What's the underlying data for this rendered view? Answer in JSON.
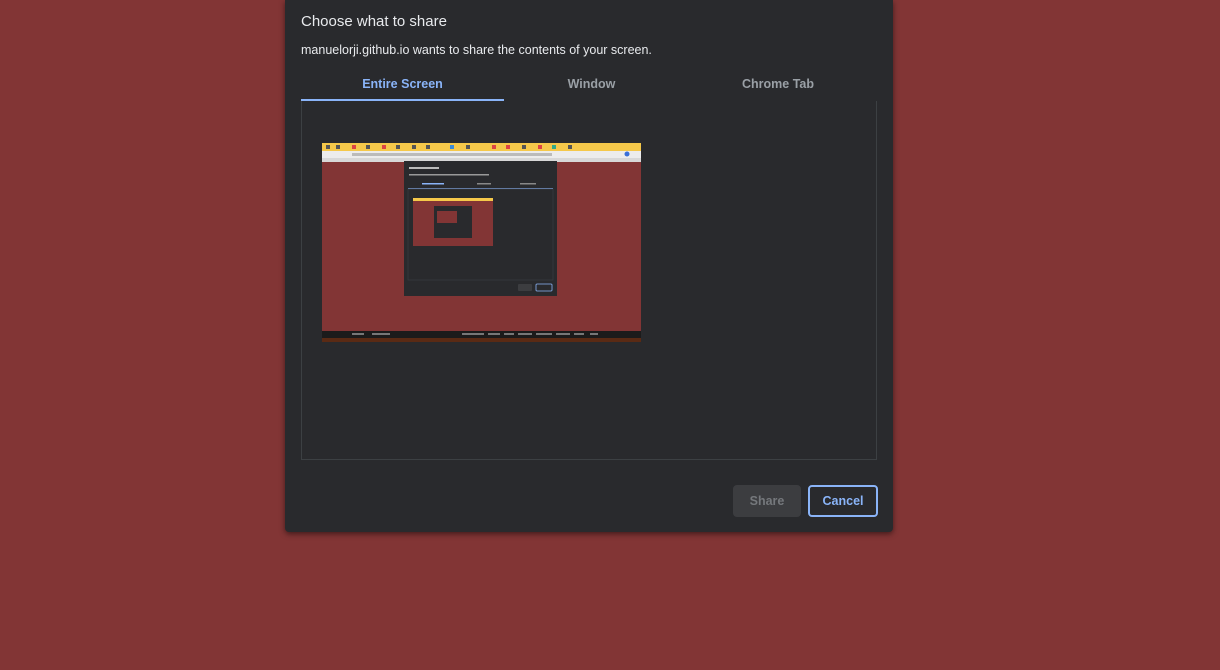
{
  "dialog": {
    "title": "Choose what to share",
    "subtitle": "manuelorji.github.io wants to share the contents of your screen."
  },
  "tabs": [
    {
      "label": "Entire Screen",
      "active": true
    },
    {
      "label": "Window",
      "active": false
    },
    {
      "label": "Chrome Tab",
      "active": false
    }
  ],
  "buttons": {
    "share_label": "Share",
    "cancel_label": "Cancel"
  },
  "colors": {
    "background": "#823535",
    "dialog": "#292a2d",
    "accent": "#8ab4f8",
    "text": "#e8eaed",
    "muted": "#9aa0a6"
  }
}
